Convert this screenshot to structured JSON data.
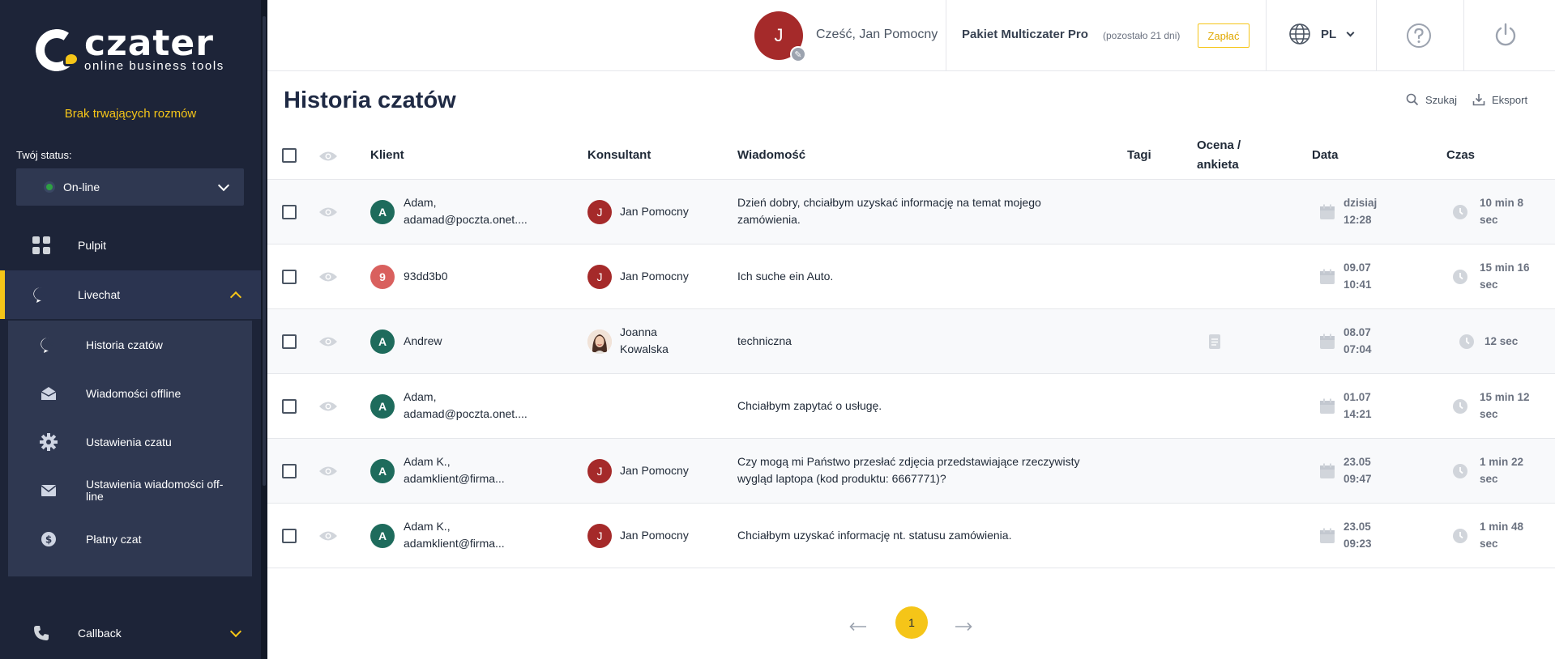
{
  "brand": {
    "name": "czater",
    "tagline": "online business tools",
    "accent": "#f5c518",
    "sidebar_bg": "#1d2438"
  },
  "sidebar": {
    "no_chats": "Brak trwających rozmów",
    "status_label": "Twój status:",
    "status_value": "On-line",
    "nav": [
      {
        "label": "Pulpit",
        "icon": "grid-icon"
      },
      {
        "label": "Livechat",
        "icon": "chat-bubble-icon"
      },
      {
        "label": "Callback",
        "icon": "phone-icon"
      }
    ],
    "submenu": [
      {
        "label": "Historia czatów",
        "icon": "chat-bubble-icon"
      },
      {
        "label": "Wiadomości offline",
        "icon": "envelope-open-icon"
      },
      {
        "label": "Ustawienia czatu",
        "icon": "gear-icon"
      },
      {
        "label": "Ustawienia wiadomości off-line",
        "icon": "envelope-icon"
      },
      {
        "label": "Płatny czat",
        "icon": "dollar-icon"
      }
    ]
  },
  "topbar": {
    "avatar_initial": "J",
    "greeting": "Cześć, Jan Pomocny",
    "plan_name": "Pakiet Multiczater Pro",
    "plan_days": "(pozostało 21 dni)",
    "pay_label": "Zapłać",
    "language": "PL"
  },
  "page": {
    "title": "Historia czatów",
    "search_label": "Szukaj",
    "export_label": "Eksport"
  },
  "table": {
    "headers": {
      "client": "Klient",
      "consultant": "Konsultant",
      "message": "Wiadomość",
      "tags": "Tagi",
      "rating_1": "Ocena /",
      "rating_2": "ankieta",
      "date": "Data",
      "time": "Czas"
    },
    "rows": [
      {
        "avatar": "A",
        "avatar_color": "#1e6b5c",
        "client_1": "Adam,",
        "client_2": "adamad@poczta.onet....",
        "consultant_initial": "J",
        "consultant_1": "Jan Pomocny",
        "consultant_2": "",
        "message_1": "Dzień dobry, chciałbym uzyskać informację na temat mojego",
        "message_2": "zamówienia.",
        "date_1": "dzisiaj",
        "date_2": "12:28",
        "time_1": "10 min 8",
        "time_2": "sec"
      },
      {
        "avatar": "9",
        "avatar_color": "#d9605e",
        "client_1": "93dd3b0",
        "client_2": "",
        "consultant_initial": "J",
        "consultant_1": "Jan Pomocny",
        "consultant_2": "",
        "message_1": "Ich suche ein Auto.",
        "message_2": "",
        "date_1": "09.07",
        "date_2": "10:41",
        "time_1": "15 min 16",
        "time_2": "sec"
      },
      {
        "avatar": "A",
        "avatar_color": "#1e6b5c",
        "client_1": "Andrew",
        "client_2": "",
        "consultant_initial": "",
        "consultant_1": "Joanna",
        "consultant_2": "Kowalska",
        "message_1": "techniczna",
        "message_2": "",
        "date_1": "08.07",
        "date_2": "07:04",
        "time_1": "12 sec",
        "time_2": ""
      },
      {
        "avatar": "A",
        "avatar_color": "#1e6b5c",
        "client_1": "Adam,",
        "client_2": "adamad@poczta.onet....",
        "consultant_initial": "",
        "consultant_1": "",
        "consultant_2": "",
        "message_1": "Chciałbym zapytać o usługę.",
        "message_2": "",
        "date_1": "01.07",
        "date_2": "14:21",
        "time_1": "15 min 12",
        "time_2": "sec"
      },
      {
        "avatar": "A",
        "avatar_color": "#1e6b5c",
        "client_1": "Adam K.,",
        "client_2": "adamklient@firma...",
        "consultant_initial": "J",
        "consultant_1": "Jan Pomocny",
        "consultant_2": "",
        "message_1": "Czy mogą mi Państwo przesłać zdjęcia przedstawiające rzeczywisty",
        "message_2": "wygląd laptopa (kod produktu: 6667771)?",
        "date_1": "23.05",
        "date_2": "09:47",
        "time_1": "1 min 22",
        "time_2": "sec"
      },
      {
        "avatar": "A",
        "avatar_color": "#1e6b5c",
        "client_1": "Adam K.,",
        "client_2": "adamklient@firma...",
        "consultant_initial": "J",
        "consultant_1": "Jan Pomocny",
        "consultant_2": "",
        "message_1": "Chciałbym uzyskać informację nt. statusu zamówienia.",
        "message_2": "",
        "date_1": "23.05",
        "date_2": "09:23",
        "time_1": "1 min 48",
        "time_2": "sec"
      }
    ]
  },
  "pagination": {
    "current": "1"
  }
}
